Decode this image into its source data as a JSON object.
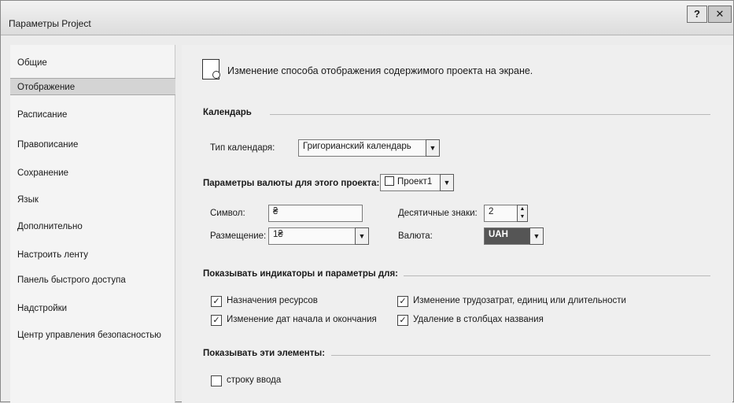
{
  "window": {
    "title": "Параметры Project",
    "help_glyph": "?",
    "close_glyph": "✕"
  },
  "sidebar": {
    "items": [
      {
        "label": "Общие"
      },
      {
        "label": "Отображение",
        "selected": true
      },
      {
        "label": "Расписание"
      },
      {
        "label": "Правописание"
      },
      {
        "label": "Сохранение"
      },
      {
        "label": "Язык"
      },
      {
        "label": "Дополнительно"
      },
      {
        "label": "Настроить ленту"
      },
      {
        "label": "Панель быстрого доступа"
      },
      {
        "label": "Надстройки"
      },
      {
        "label": "Центр управления безопасностью"
      }
    ]
  },
  "content": {
    "header": "Изменение способа отображения содержимого проекта на экране.",
    "calendar": {
      "section_title": "Календарь",
      "type_label": "Тип календаря:",
      "type_value": "Григорианский календарь"
    },
    "currency": {
      "section_title": "Параметры валюты для этого проекта:",
      "project_value": "Проект1",
      "symbol_label": "Символ:",
      "symbol_value": "₴",
      "placement_label": "Размещение:",
      "placement_value": "1₴",
      "decimals_label": "Десятичные знаки:",
      "decimals_value": "2",
      "currency_label": "Валюта:",
      "currency_value": "UAH"
    },
    "indicators": {
      "section_title": "Показывать индикаторы и параметры для:",
      "resource_assignments": {
        "label": "Назначения ресурсов",
        "checked": true
      },
      "start_finish_changes": {
        "label": "Изменение дат начала и окончания",
        "checked": true
      },
      "work_units_duration": {
        "label": "Изменение трудозатрат, единиц или длительности",
        "checked": true
      },
      "delete_in_name_columns": {
        "label": "Удаление в столбцах названия",
        "checked": true
      }
    },
    "show_elements": {
      "section_title": "Показывать эти элементы:",
      "entry_bar": {
        "label": "строку ввода",
        "checked": false
      }
    }
  },
  "icons": {
    "header": "display-settings-icon",
    "project": "project-file-icon",
    "dropdown": "chevron-down-icon",
    "spinner": "spinner-arrows-icon"
  },
  "colors": {
    "selected_nav": "#d4d4d4",
    "currency_highlight": "#555555"
  }
}
